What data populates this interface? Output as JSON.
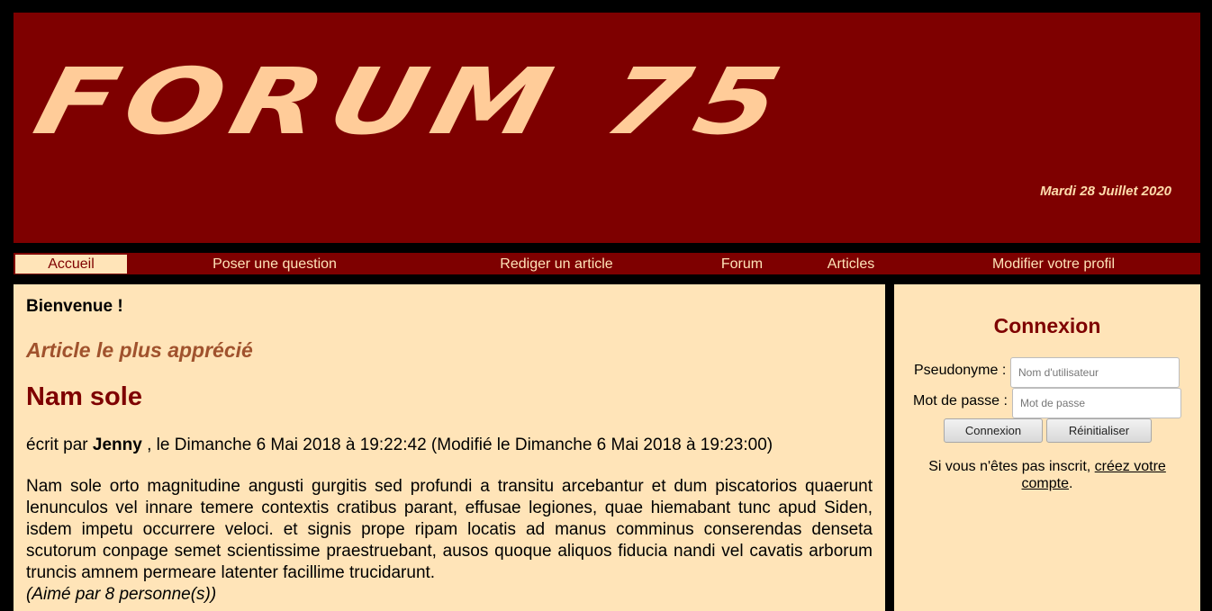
{
  "banner": {
    "logo": "FORUM 75",
    "date": "Mardi 28 Juillet 2020"
  },
  "nav": {
    "items": [
      {
        "label": "Accueil"
      },
      {
        "label": "Poser une question"
      },
      {
        "label": "Rediger un article"
      },
      {
        "label": "Forum"
      },
      {
        "label": "Articles"
      },
      {
        "label": "Modifier votre profil"
      }
    ],
    "active": "Accueil"
  },
  "main": {
    "welcome": "Bienvenue !",
    "featured_heading": "Article le plus apprécié",
    "article": {
      "title": "Nam sole",
      "byline_prefix": "écrit par",
      "author": "Jenny",
      "byline_suffix": ", le Dimanche 6 Mai 2018 à 19:22:42 (Modifié le Dimanche 6 Mai 2018 à 19:23:00)",
      "body": "Nam sole orto magnitudine angusti gurgitis sed profundi a transitu arcebantur et dum piscatorios quaerunt lenunculos vel innare temere contextis cratibus parant, effusae legiones, quae hiemabant tunc apud Siden, isdem impetu occurrere veloci. et signis prope ripam locatis ad manus comminus conserendas denseta scutorum conpage semet scientissime praestruebant, ausos quoque aliquos fiducia nandi vel cavatis arborum truncis amnem permeare latenter facillime trucidarunt.",
      "likes": "(Aimé par 8 personne(s))"
    }
  },
  "login": {
    "title": "Connexion",
    "username_label": "Pseudonyme :",
    "username_placeholder": "Nom d'utilisateur",
    "password_label": "Mot de passe :",
    "password_placeholder": "Mot de passe",
    "submit_label": "Connexion",
    "reset_label": "Réinitialiser",
    "signup_text": "Si vous n'êtes pas inscrit,",
    "signup_link": "créez votre compte",
    "signup_end": "."
  },
  "colors": {
    "brand": "#7e0000",
    "background": "#ffe4b8",
    "logo": "#ffcc99",
    "featured": "#a0522d"
  }
}
